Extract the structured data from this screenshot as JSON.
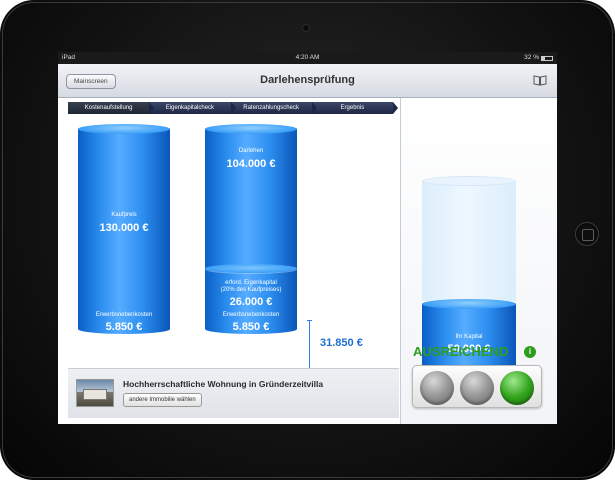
{
  "status_bar": {
    "device": "iPad",
    "time": "4:20 AM",
    "battery": "32 %"
  },
  "nav": {
    "back_label": "Mainscreen",
    "title": "Darlehensprüfung",
    "book_icon": "book-icon"
  },
  "steps": [
    "Kostenaufstellung",
    "Eigenkapitalcheck",
    "Ratenzahlungscheck",
    "Ergebnis"
  ],
  "cylinder_left": {
    "kaufpreis_label": "Kaufpreis",
    "kaufpreis_value": "130.000 €",
    "erwerb_label": "Erwerbsnebenkosten",
    "erwerb_value": "5.850 €"
  },
  "cylinder_mid": {
    "darlehen_label": "Darlehen",
    "darlehen_value": "104.000 €",
    "eigen_label_1": "erford. Eigenkapital",
    "eigen_label_2": "(20% des Kaufpreises)",
    "eigen_value": "26.000 €",
    "erwerb_label": "Erwerbsnebenkosten",
    "erwerb_value": "5.850 €"
  },
  "sum_value": "31.850 €",
  "property": {
    "title": "Hochherrschaftliche Wohnung in Gründerzeitvilla",
    "button": "andere Immobilie wählen"
  },
  "capital": {
    "label": "Ihr Kapital",
    "value": "50.000 €"
  },
  "result": {
    "text": "AUSREICHEND",
    "info_glyph": "i",
    "color": "#2e9d1e"
  },
  "traffic_light": {
    "lights": [
      "grey",
      "grey",
      "green"
    ],
    "active": "green"
  }
}
